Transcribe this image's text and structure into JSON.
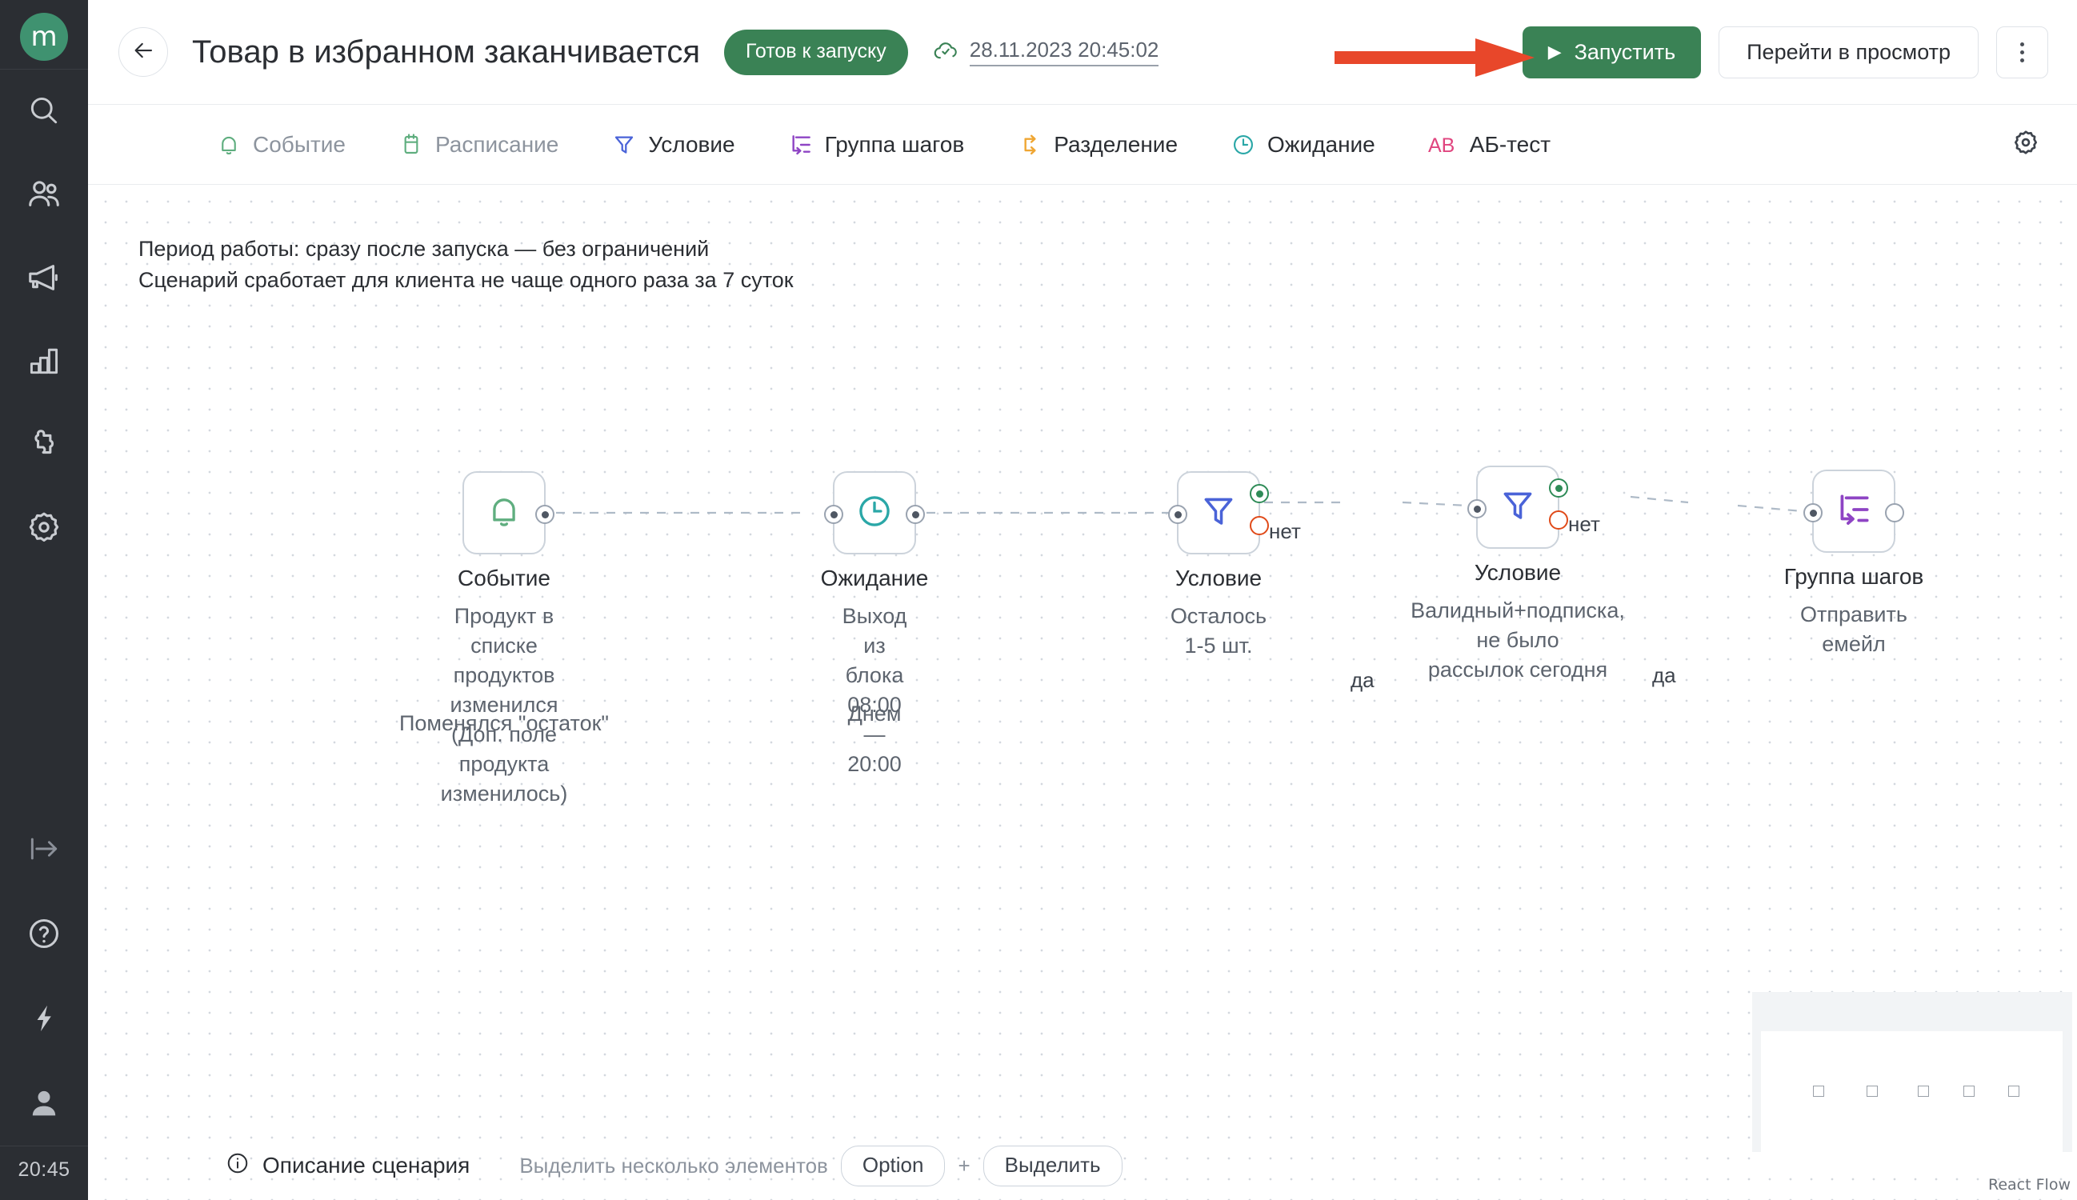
{
  "brand": {
    "logo_letter": "m",
    "logo_color": "#3f9270"
  },
  "sidebar": {
    "items": [
      {
        "name": "search-icon",
        "label": "Поиск"
      },
      {
        "name": "users-icon",
        "label": "Клиенты"
      },
      {
        "name": "megaphone-icon",
        "label": "Рассылки"
      },
      {
        "name": "bar-chart-icon",
        "label": "Аналитика"
      },
      {
        "name": "puzzle-icon",
        "label": "Интеграции"
      },
      {
        "name": "gear-icon",
        "label": "Настройки"
      }
    ],
    "bottom_items": [
      {
        "name": "expand-icon",
        "label": "Развернуть"
      },
      {
        "name": "help-icon",
        "label": "Помощь"
      },
      {
        "name": "lightning-icon",
        "label": "Быстрые действия"
      },
      {
        "name": "user-avatar-icon",
        "label": "Профиль"
      }
    ],
    "clock": "20:45"
  },
  "header": {
    "back_label": "Назад",
    "title": "Товар в избранном заканчивается",
    "status_badge": "Готов к запуску",
    "saved_timestamp": "28.11.2023 20:45:02",
    "run_button": "Запустить",
    "view_button": "Перейти в просмотр",
    "kebab_label": "Ещё",
    "accent_green": "#3a8255",
    "annotation_arrow_color": "#e8472a"
  },
  "toolbar": {
    "items": [
      {
        "label": "Событие",
        "icon": "bell-icon",
        "color": "#5fae7f",
        "state": "dim"
      },
      {
        "label": "Расписание",
        "icon": "calendar-icon",
        "color": "#5fae7f",
        "state": "dim"
      },
      {
        "label": "Условие",
        "icon": "filter-icon",
        "color": "#4a63d8",
        "state": "on"
      },
      {
        "label": "Группа шагов",
        "icon": "steps-group-icon",
        "color": "#8e44c4",
        "state": "on"
      },
      {
        "label": "Разделение",
        "icon": "split-icon",
        "color": "#efa633",
        "state": "on"
      },
      {
        "label": "Ожидание",
        "icon": "clock-icon",
        "color": "#2aa7a7",
        "state": "on"
      },
      {
        "label": "АБ-тест",
        "icon": "ab-test-icon",
        "color": "#e0457f",
        "state": "on"
      }
    ],
    "settings_icon": "gear-icon"
  },
  "canvas": {
    "period_text": "Период работы: сразу после запуска — без ограничений\nСценарий сработает для клиента не чаще одного раза за 7 суток",
    "nodes": [
      {
        "id": "event",
        "icon": "bell-icon",
        "icon_color": "#5fae7f",
        "title": "Событие",
        "subtitle": "Продукт в списке продуктов\nизменился (Доп. поле продукта\nизменилось)",
        "subtitle2": "Поменялся \"остаток\""
      },
      {
        "id": "wait",
        "icon": "clock-icon",
        "icon_color": "#2aa7a7",
        "title": "Ожидание",
        "subtitle": "Выход из блока\n08:00 — 20:00",
        "subtitle2": "Днем"
      },
      {
        "id": "condition-1",
        "icon": "filter-icon",
        "icon_color": "#4a63d8",
        "title": "Условие",
        "subtitle": "Осталось 1-5 шт.",
        "yes_label": "да",
        "no_label": "нет"
      },
      {
        "id": "condition-2",
        "icon": "filter-icon",
        "icon_color": "#4a63d8",
        "title": "Условие",
        "subtitle": "Валидный+подписка, не было\nрассылок сегодня",
        "yes_label": "да",
        "no_label": "нет"
      },
      {
        "id": "steps-group",
        "icon": "steps-group-icon",
        "icon_color": "#8e44c4",
        "title": "Группа шагов",
        "subtitle": "Отправить емейл"
      }
    ],
    "minimap_label": "React Flow"
  },
  "bottombar": {
    "description_label": "Описание сценария",
    "hint_text": "Выделить несколько элементов",
    "key_option": "Option",
    "key_plus": "+",
    "key_select": "Выделить"
  }
}
